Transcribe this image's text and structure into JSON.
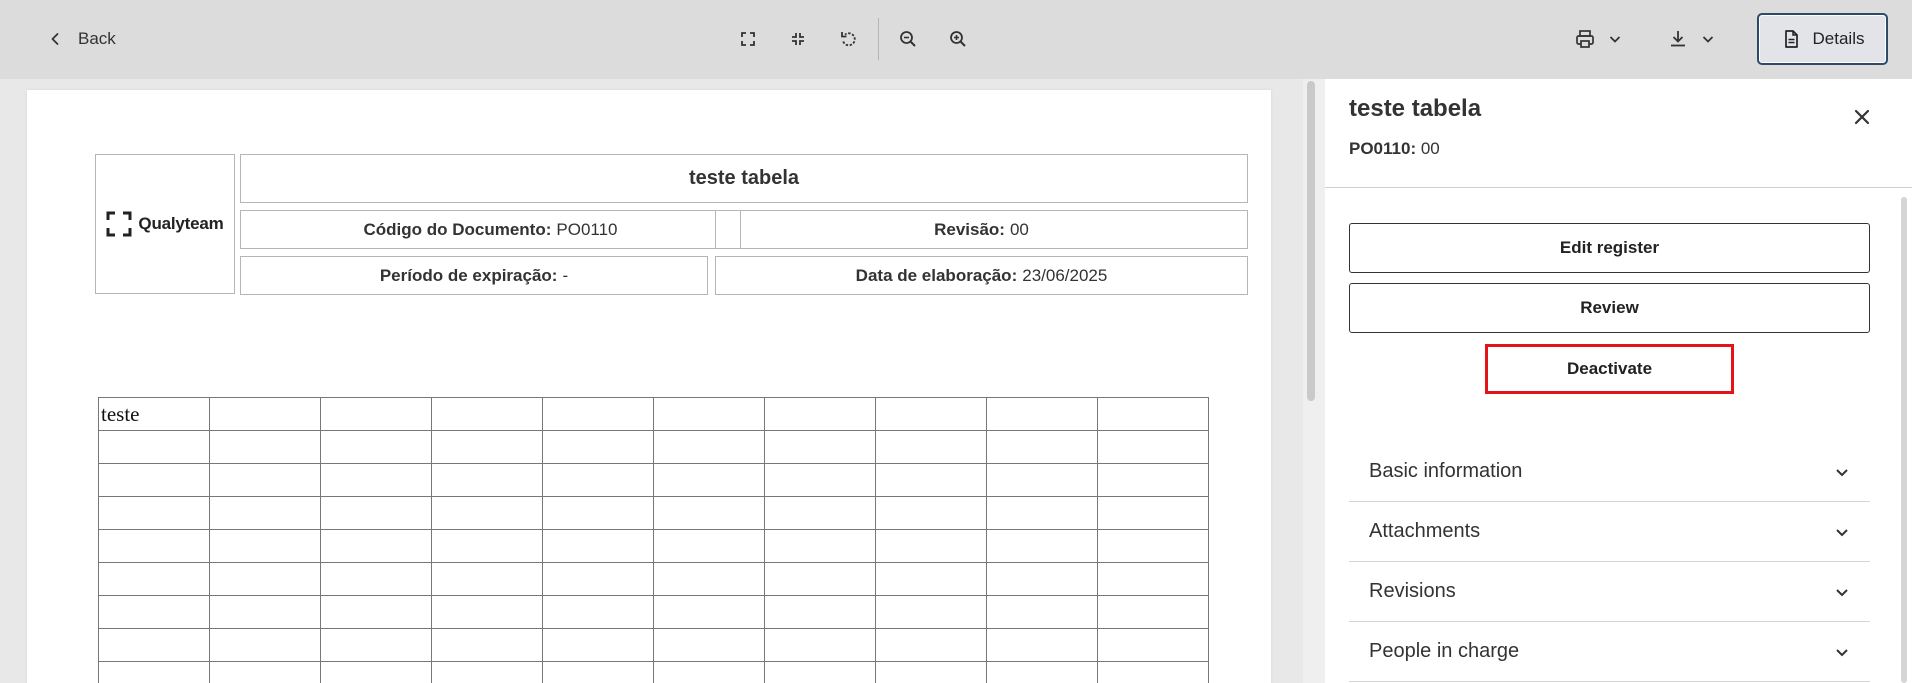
{
  "toolbar": {
    "back_label": "Back",
    "details_label": "Details"
  },
  "icons": {
    "back": "chevron-left-icon",
    "fullscreen": "fullscreen-icon",
    "exit_fullscreen": "exit-fullscreen-icon",
    "rotate": "rotate-icon",
    "zoom_out": "zoom-out-icon",
    "zoom_in": "zoom-in-icon",
    "print": "printer-icon",
    "download": "download-icon",
    "details": "document-icon",
    "close": "close-icon",
    "expand": "chevron-down-icon"
  },
  "document": {
    "logo_text": "Qualyteam",
    "title": "teste tabela",
    "code_label": "Código do Documento:",
    "code_value": "PO0110",
    "revision_label": "Revisão:",
    "revision_value": "00",
    "expiration_label": "Período de expiração:",
    "expiration_value": "-",
    "created_label": "Data de elaboração:",
    "created_value": "23/06/2025",
    "table": {
      "rows": [
        [
          "teste",
          "",
          "",
          "",
          "",
          "",
          "",
          "",
          "",
          ""
        ],
        [
          "",
          "",
          "",
          "",
          "",
          "",
          "",
          "",
          "",
          ""
        ],
        [
          "",
          "",
          "",
          "",
          "",
          "",
          "",
          "",
          "",
          ""
        ],
        [
          "",
          "",
          "",
          "",
          "",
          "",
          "",
          "",
          "",
          ""
        ],
        [
          "",
          "",
          "",
          "",
          "",
          "",
          "",
          "",
          "",
          ""
        ],
        [
          "",
          "",
          "",
          "",
          "",
          "",
          "",
          "",
          "",
          ""
        ],
        [
          "",
          "",
          "",
          "",
          "",
          "",
          "",
          "",
          "",
          ""
        ],
        [
          "",
          "",
          "",
          "",
          "",
          "",
          "",
          "",
          "",
          ""
        ],
        [
          "",
          "",
          "",
          "",
          "",
          "",
          "",
          "",
          "",
          ""
        ]
      ]
    }
  },
  "panel": {
    "title": "teste tabela",
    "code": "PO0110:",
    "revision": "00",
    "buttons": {
      "edit": "Edit register",
      "review": "Review",
      "deactivate": "Deactivate"
    },
    "sections": [
      "Basic information",
      "Attachments",
      "Revisions",
      "People in charge"
    ]
  },
  "colors": {
    "toolbar_bg": "#dcdcdc",
    "details_border": "#2e4a6a",
    "highlight_red": "#e4131a"
  }
}
